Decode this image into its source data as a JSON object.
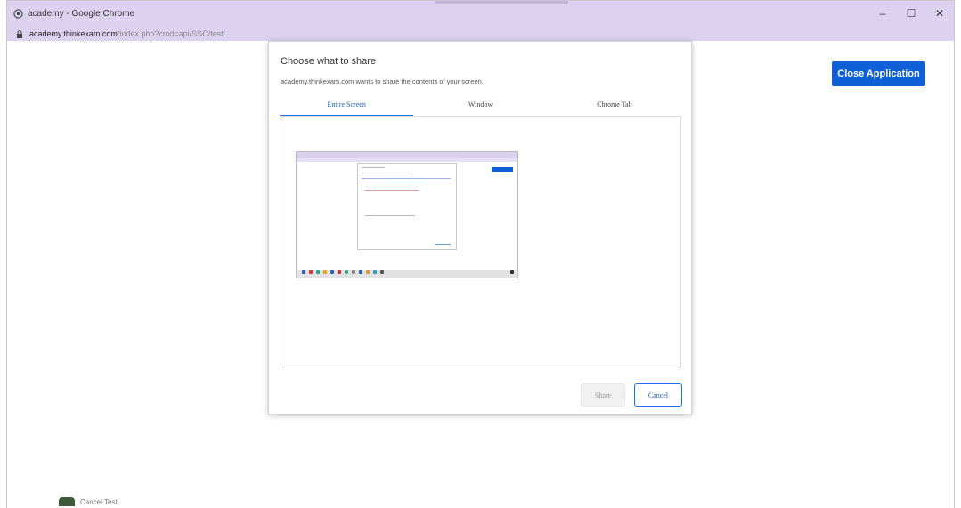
{
  "browser": {
    "window_title": "academy - Google Chrome",
    "url_host": "academy.thinkexam.com",
    "url_path": "/index.php?cmd=api/SSC/test",
    "minimize_glyph": "–",
    "maximize_glyph": "☐",
    "close_glyph": "✕"
  },
  "page": {
    "close_button_label": "Close Application",
    "bottom_item_label": "Cancel Test"
  },
  "share_dialog": {
    "title": "Choose what to share",
    "subtitle": "academy.thinkexam.com wants to share the contents of your screen.",
    "tabs": [
      {
        "label": "Entire Screen",
        "active": true
      },
      {
        "label": "Window",
        "active": false
      },
      {
        "label": "Chrome Tab",
        "active": false
      }
    ],
    "share_label": "Share",
    "cancel_label": "Cancel"
  },
  "colors": {
    "titlebar": "#dcd2ef",
    "accent": "#1a73e8",
    "close_app_bg": "#0f5fd6"
  }
}
